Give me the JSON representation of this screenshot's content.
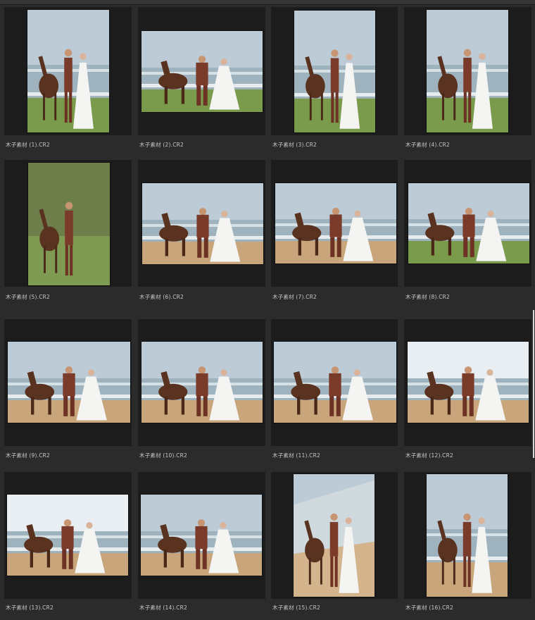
{
  "colors": {
    "background": "#2b2b2b",
    "frame": "#1c1c1c",
    "label": "#c9c9c9"
  },
  "thumbnails": [
    {
      "filename": "木子素材 (1).CR2",
      "orientation": "portrait",
      "scene": "beach-horse"
    },
    {
      "filename": "木子素材 (2).CR2",
      "orientation": "landscape",
      "scene": "beach-horse"
    },
    {
      "filename": "木子素材 (3).CR2",
      "orientation": "portrait",
      "scene": "beach-horse"
    },
    {
      "filename": "木子素材 (4).CR2",
      "orientation": "portrait",
      "scene": "beach-horse"
    },
    {
      "filename": "木子素材 (5).CR2",
      "orientation": "portrait",
      "scene": "groom-horse"
    },
    {
      "filename": "木子素材 (6).CR2",
      "orientation": "landscape",
      "scene": "sand-horse"
    },
    {
      "filename": "木子素材 (7).CR2",
      "orientation": "landscape",
      "scene": "kiss-horse"
    },
    {
      "filename": "木子素材 (8).CR2",
      "orientation": "landscape",
      "scene": "beach-horse"
    },
    {
      "filename": "木子素材 (9).CR2",
      "orientation": "landscape",
      "scene": "kiss-horse"
    },
    {
      "filename": "木子素材 (10).CR2",
      "orientation": "landscape",
      "scene": "kiss-horse"
    },
    {
      "filename": "木子素材 (11).CR2",
      "orientation": "landscape",
      "scene": "riding-horse"
    },
    {
      "filename": "木子素材 (12).CR2",
      "orientation": "landscape",
      "scene": "bright-horse"
    },
    {
      "filename": "木子素材 (13).CR2",
      "orientation": "landscape",
      "scene": "bright-horse"
    },
    {
      "filename": "木子素材 (14).CR2",
      "orientation": "landscape",
      "scene": "walking"
    },
    {
      "filename": "木子素材 (15).CR2",
      "orientation": "portrait",
      "scene": "diagonal-beach"
    },
    {
      "filename": "木子素材 (16).CR2",
      "orientation": "portrait",
      "scene": "riding-horse"
    }
  ]
}
